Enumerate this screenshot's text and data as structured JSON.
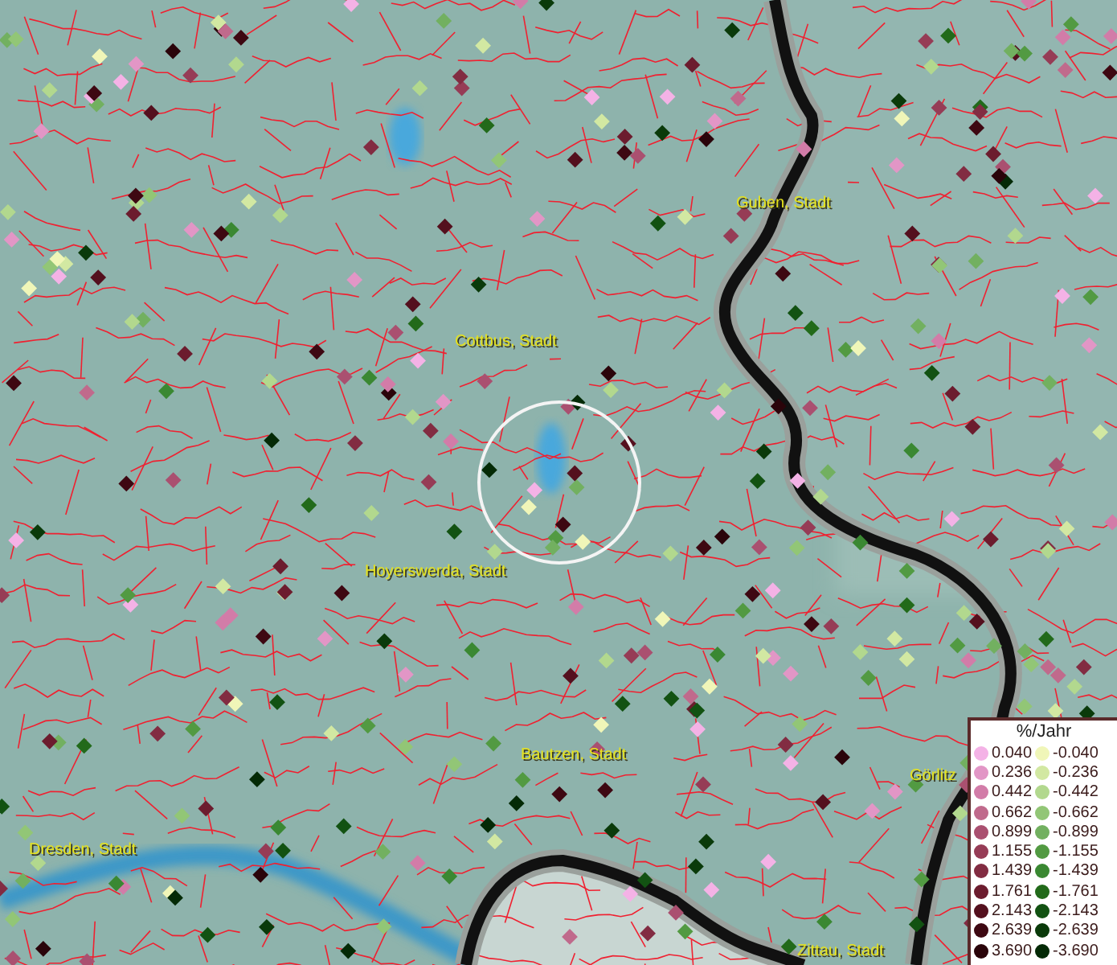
{
  "map": {
    "places": [
      {
        "kind": "city",
        "name": "Guben, Stadt"
      },
      {
        "kind": "city",
        "name": "Cottbus, Stadt"
      },
      {
        "kind": "city",
        "name": "Hoyerswerda, Stadt"
      },
      {
        "kind": "city",
        "name": "Bautzen, Stadt"
      },
      {
        "kind": "city",
        "name": "Dresden, Stadt"
      },
      {
        "kind": "city",
        "name": "Görlitz"
      },
      {
        "kind": "city",
        "name": "Zittau, Stadt"
      }
    ]
  },
  "legend": {
    "title": "%/Jahr",
    "positive": [
      {
        "label": "0.040",
        "color": "#f4b2e6"
      },
      {
        "label": "0.236",
        "color": "#e296c6"
      },
      {
        "label": "0.442",
        "color": "#d27ca8"
      },
      {
        "label": "0.662",
        "color": "#c06a8c"
      },
      {
        "label": "0.899",
        "color": "#aa5070"
      },
      {
        "label": "1.155",
        "color": "#963c56"
      },
      {
        "label": "1.439",
        "color": "#822c42"
      },
      {
        "label": "1.761",
        "color": "#6c1c2e"
      },
      {
        "label": "2.143",
        "color": "#54101e"
      },
      {
        "label": "2.639",
        "color": "#3e0812"
      },
      {
        "label": "3.690",
        "color": "#2a040a"
      }
    ],
    "negative": [
      {
        "label": "-0.040",
        "color": "#f0f6b8"
      },
      {
        "label": "-0.236",
        "color": "#d2e8a2"
      },
      {
        "label": "-0.442",
        "color": "#b2d88e"
      },
      {
        "label": "-0.662",
        "color": "#92c676"
      },
      {
        "label": "-0.899",
        "color": "#72b060"
      },
      {
        "label": "-1.155",
        "color": "#529a42"
      },
      {
        "label": "-1.439",
        "color": "#3a8832"
      },
      {
        "label": "-1.761",
        "color": "#226a1a"
      },
      {
        "label": "-2.143",
        "color": "#125212"
      },
      {
        "label": "-2.639",
        "color": "#0a3a0a"
      },
      {
        "label": "-3.690",
        "color": "#042a06"
      }
    ]
  }
}
